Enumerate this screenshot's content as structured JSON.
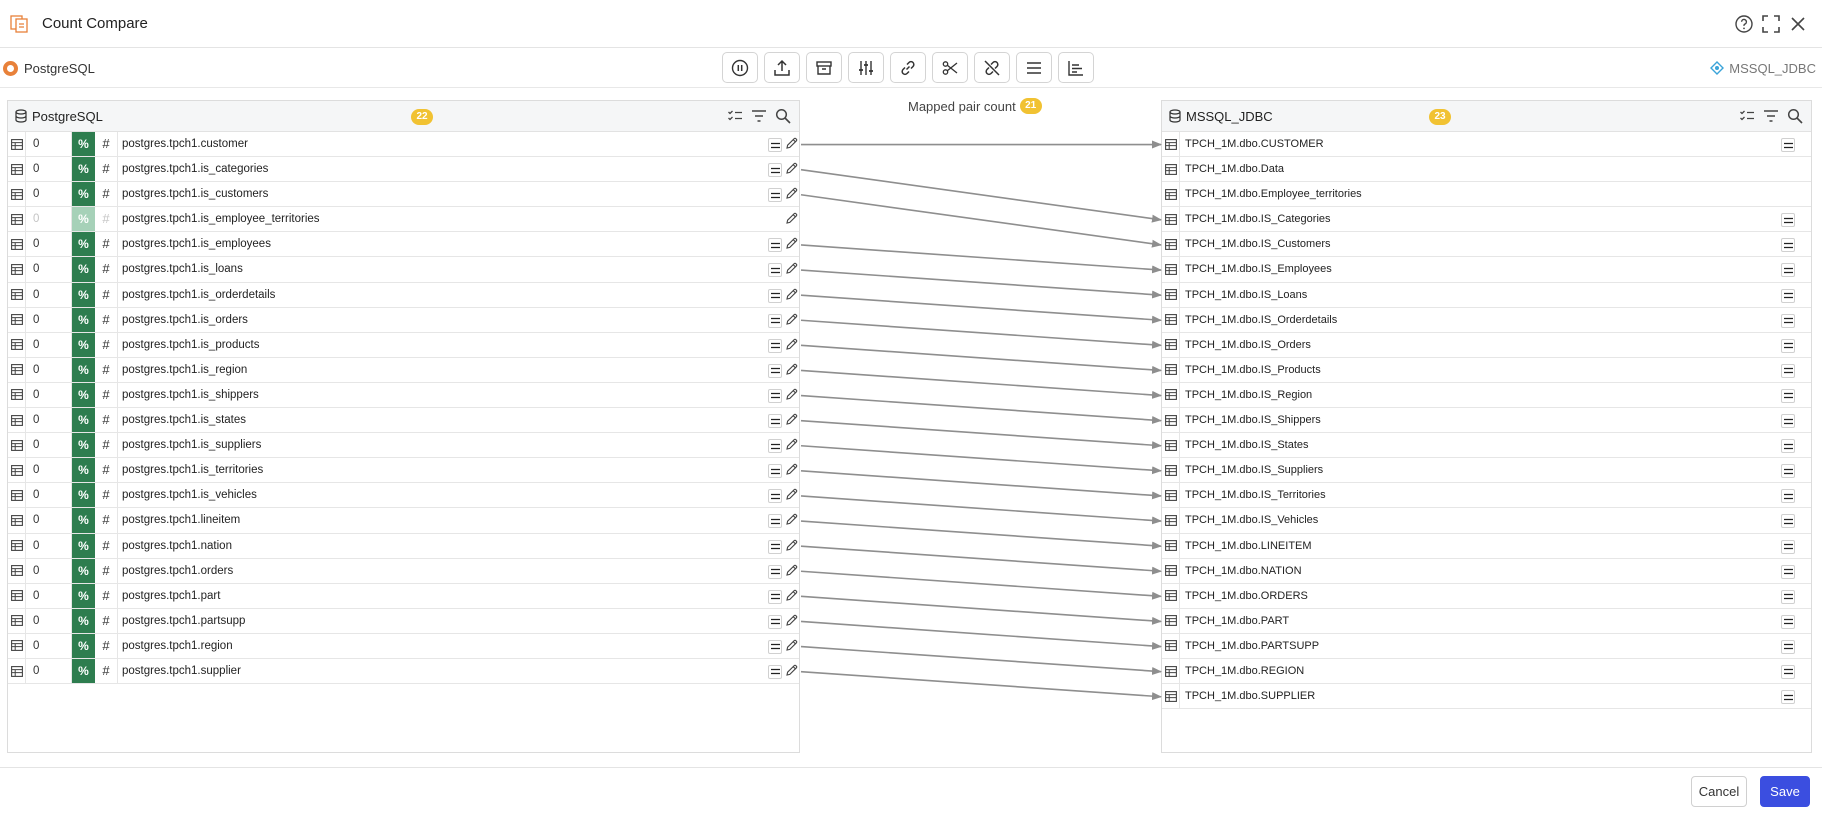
{
  "window": {
    "title": "Count Compare",
    "icon": "count-compare-icon"
  },
  "toolbar": {
    "source": "PostgreSQL",
    "target": "MSSQL_JDBC",
    "tools": [
      "pause-icon",
      "upload-icon",
      "archive-icon",
      "sliders-icon",
      "link-icon",
      "scissors-icon",
      "unlink-icon",
      "list-icon",
      "chart-icon"
    ]
  },
  "left_panel": {
    "name": "PostgreSQL",
    "count": "22"
  },
  "right_panel": {
    "name": "MSSQL_JDBC",
    "count": "23"
  },
  "mapped": {
    "label": "Mapped pair count",
    "count": "21"
  },
  "left_rows": [
    {
      "count": "0",
      "pct": "%",
      "hash": "#",
      "name": "postgres.tpch1.customer",
      "mapped": true
    },
    {
      "count": "0",
      "pct": "%",
      "hash": "#",
      "name": "postgres.tpch1.is_categories",
      "mapped": true
    },
    {
      "count": "0",
      "pct": "%",
      "hash": "#",
      "name": "postgres.tpch1.is_customers",
      "mapped": true
    },
    {
      "count": "0",
      "pct": "%",
      "hash": "#",
      "name": "postgres.tpch1.is_employee_territories",
      "mapped": false
    },
    {
      "count": "0",
      "pct": "%",
      "hash": "#",
      "name": "postgres.tpch1.is_employees",
      "mapped": true
    },
    {
      "count": "0",
      "pct": "%",
      "hash": "#",
      "name": "postgres.tpch1.is_loans",
      "mapped": true
    },
    {
      "count": "0",
      "pct": "%",
      "hash": "#",
      "name": "postgres.tpch1.is_orderdetails",
      "mapped": true
    },
    {
      "count": "0",
      "pct": "%",
      "hash": "#",
      "name": "postgres.tpch1.is_orders",
      "mapped": true
    },
    {
      "count": "0",
      "pct": "%",
      "hash": "#",
      "name": "postgres.tpch1.is_products",
      "mapped": true
    },
    {
      "count": "0",
      "pct": "%",
      "hash": "#",
      "name": "postgres.tpch1.is_region",
      "mapped": true
    },
    {
      "count": "0",
      "pct": "%",
      "hash": "#",
      "name": "postgres.tpch1.is_shippers",
      "mapped": true
    },
    {
      "count": "0",
      "pct": "%",
      "hash": "#",
      "name": "postgres.tpch1.is_states",
      "mapped": true
    },
    {
      "count": "0",
      "pct": "%",
      "hash": "#",
      "name": "postgres.tpch1.is_suppliers",
      "mapped": true
    },
    {
      "count": "0",
      "pct": "%",
      "hash": "#",
      "name": "postgres.tpch1.is_territories",
      "mapped": true
    },
    {
      "count": "0",
      "pct": "%",
      "hash": "#",
      "name": "postgres.tpch1.is_vehicles",
      "mapped": true
    },
    {
      "count": "0",
      "pct": "%",
      "hash": "#",
      "name": "postgres.tpch1.lineitem",
      "mapped": true
    },
    {
      "count": "0",
      "pct": "%",
      "hash": "#",
      "name": "postgres.tpch1.nation",
      "mapped": true
    },
    {
      "count": "0",
      "pct": "%",
      "hash": "#",
      "name": "postgres.tpch1.orders",
      "mapped": true
    },
    {
      "count": "0",
      "pct": "%",
      "hash": "#",
      "name": "postgres.tpch1.part",
      "mapped": true
    },
    {
      "count": "0",
      "pct": "%",
      "hash": "#",
      "name": "postgres.tpch1.partsupp",
      "mapped": true
    },
    {
      "count": "0",
      "pct": "%",
      "hash": "#",
      "name": "postgres.tpch1.region",
      "mapped": true
    },
    {
      "count": "0",
      "pct": "%",
      "hash": "#",
      "name": "postgres.tpch1.supplier",
      "mapped": true
    }
  ],
  "right_rows": [
    {
      "name": "TPCH_1M.dbo.CUSTOMER",
      "mapped": true
    },
    {
      "name": "TPCH_1M.dbo.Data",
      "mapped": false
    },
    {
      "name": "TPCH_1M.dbo.Employee_territories",
      "mapped": false
    },
    {
      "name": "TPCH_1M.dbo.IS_Categories",
      "mapped": true
    },
    {
      "name": "TPCH_1M.dbo.IS_Customers",
      "mapped": true
    },
    {
      "name": "TPCH_1M.dbo.IS_Employees",
      "mapped": true
    },
    {
      "name": "TPCH_1M.dbo.IS_Loans",
      "mapped": true
    },
    {
      "name": "TPCH_1M.dbo.IS_Orderdetails",
      "mapped": true
    },
    {
      "name": "TPCH_1M.dbo.IS_Orders",
      "mapped": true
    },
    {
      "name": "TPCH_1M.dbo.IS_Products",
      "mapped": true
    },
    {
      "name": "TPCH_1M.dbo.IS_Region",
      "mapped": true
    },
    {
      "name": "TPCH_1M.dbo.IS_Shippers",
      "mapped": true
    },
    {
      "name": "TPCH_1M.dbo.IS_States",
      "mapped": true
    },
    {
      "name": "TPCH_1M.dbo.IS_Suppliers",
      "mapped": true
    },
    {
      "name": "TPCH_1M.dbo.IS_Territories",
      "mapped": true
    },
    {
      "name": "TPCH_1M.dbo.IS_Vehicles",
      "mapped": true
    },
    {
      "name": "TPCH_1M.dbo.LINEITEM",
      "mapped": true
    },
    {
      "name": "TPCH_1M.dbo.NATION",
      "mapped": true
    },
    {
      "name": "TPCH_1M.dbo.ORDERS",
      "mapped": true
    },
    {
      "name": "TPCH_1M.dbo.PART",
      "mapped": true
    },
    {
      "name": "TPCH_1M.dbo.PARTSUPP",
      "mapped": true
    },
    {
      "name": "TPCH_1M.dbo.REGION",
      "mapped": true
    },
    {
      "name": "TPCH_1M.dbo.SUPPLIER",
      "mapped": true
    }
  ],
  "mappings": [
    [
      0,
      0
    ],
    [
      1,
      3
    ],
    [
      2,
      4
    ],
    [
      4,
      5
    ],
    [
      5,
      6
    ],
    [
      6,
      7
    ],
    [
      7,
      8
    ],
    [
      8,
      9
    ],
    [
      9,
      10
    ],
    [
      10,
      11
    ],
    [
      11,
      12
    ],
    [
      12,
      13
    ],
    [
      13,
      14
    ],
    [
      14,
      15
    ],
    [
      15,
      16
    ],
    [
      16,
      17
    ],
    [
      17,
      18
    ],
    [
      18,
      19
    ],
    [
      19,
      20
    ],
    [
      20,
      21
    ],
    [
      21,
      22
    ]
  ],
  "buttons": {
    "cancel": "Cancel",
    "save": "Save"
  },
  "colors": {
    "accent": "#3b4ee0",
    "badge": "#f1c232",
    "pct": "#2e7d4f",
    "link": "#8e8e8e"
  }
}
